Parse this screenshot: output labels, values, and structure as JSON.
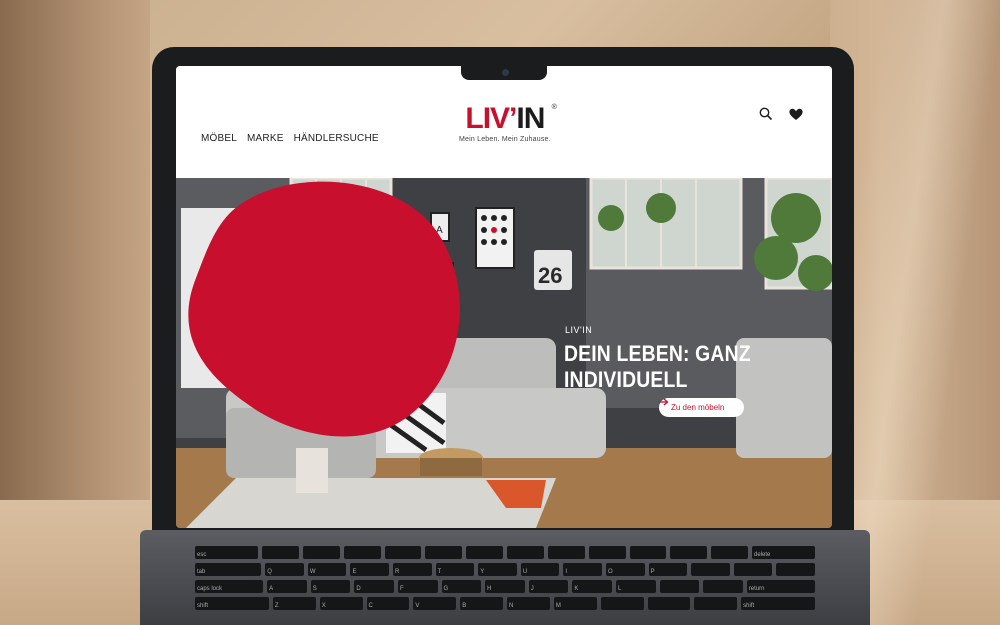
{
  "site": {
    "nav": [
      {
        "label": "MÖBEL"
      },
      {
        "label": "MARKE"
      },
      {
        "label": "HÄNDLERSUCHE"
      }
    ],
    "logo": {
      "part1": "LIV",
      "apostrophe": "’",
      "part2": "IN",
      "registered": "®",
      "tagline": "Mein Leben. Mein Zuhause."
    },
    "header_icons": [
      "search-icon",
      "heart-icon"
    ],
    "hero": {
      "calendar_number": "26",
      "poster_letter": "A",
      "promo": {
        "kicker": "LIV'IN",
        "title": "DEIN LEBEN: GANZ INDIVIDUELL",
        "button_label": "Zu den möbeln",
        "button_icon": "arrow-right-icon"
      }
    },
    "colors": {
      "brand_red": "#c8102e",
      "text_dark": "#1c1c1c"
    }
  },
  "keyboard": {
    "rows": [
      [
        "esc",
        "",
        "",
        "",
        "",
        "",
        "",
        "",
        "",
        "",
        "",
        "",
        "",
        "delete"
      ],
      [
        "tab",
        "Q",
        "W",
        "E",
        "R",
        "T",
        "Y",
        "U",
        "I",
        "O",
        "P",
        "",
        "",
        ""
      ],
      [
        "caps lock",
        "A",
        "S",
        "D",
        "F",
        "G",
        "H",
        "J",
        "K",
        "L",
        "",
        "",
        "return"
      ],
      [
        "shift",
        "Z",
        "X",
        "C",
        "V",
        "B",
        "N",
        "M",
        "",
        "",
        "",
        "shift"
      ]
    ]
  }
}
